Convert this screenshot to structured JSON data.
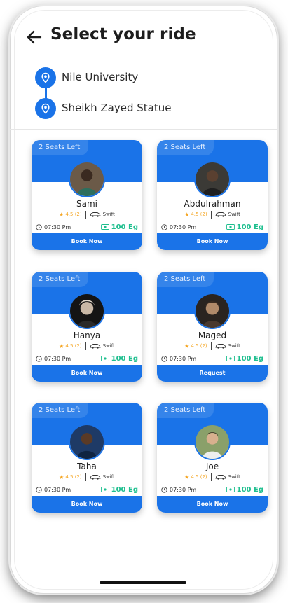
{
  "header": {
    "title": "Select your ride",
    "back_icon": "arrow-left-icon"
  },
  "route": {
    "origin": "Nile University",
    "destination": "Sheikh Zayed Statue",
    "pin_icon": "location-pin-icon"
  },
  "colors": {
    "accent": "#1a73e8",
    "price": "#1fbf8f",
    "rating": "#f5a623"
  },
  "rides": [
    {
      "seats": "2 Seats Left",
      "name": "Sami",
      "rating": "4.5 (2)",
      "car": "Swift",
      "time": "07:30 Pm",
      "price": "100 Eg",
      "action": "Book Now"
    },
    {
      "seats": "2 Seats Left",
      "name": "Abdulrahman",
      "rating": "4.5 (2)",
      "car": "Swift",
      "time": "07:30 Pm",
      "price": "100 Eg",
      "action": "Book Now"
    },
    {
      "seats": "2 Seats Left",
      "name": "Hanya",
      "rating": "4.5 (2)",
      "car": "Swift",
      "time": "07:30 Pm",
      "price": "100 Eg",
      "action": "Book Now"
    },
    {
      "seats": "2 Seats Left",
      "name": "Maged",
      "rating": "4.5 (2)",
      "car": "Swift",
      "time": "07:30 Pm",
      "price": "100 Eg",
      "action": "Request"
    },
    {
      "seats": "2 Seats Left",
      "name": "Taha",
      "rating": "4.5 (2)",
      "car": "Swift",
      "time": "07:30 Pm",
      "price": "100 Eg",
      "action": "Book Now"
    },
    {
      "seats": "2 Seats Left",
      "name": "Joe",
      "rating": "4.5 (2)",
      "car": "Swift",
      "time": "07:30 Pm",
      "price": "100 Eg",
      "action": "Book Now"
    }
  ]
}
